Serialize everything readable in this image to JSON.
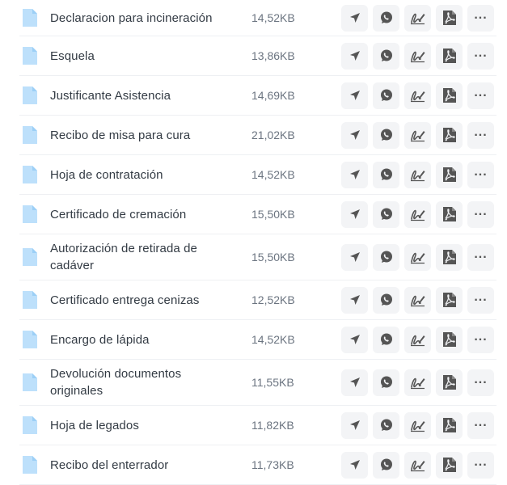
{
  "documents": [
    {
      "name": "Declaracion para incineración",
      "size": "14,52KB"
    },
    {
      "name": "Esquela",
      "size": "13,86KB"
    },
    {
      "name": "Justificante Asistencia",
      "size": "14,69KB"
    },
    {
      "name": "Recibo de misa para cura",
      "size": "21,02KB"
    },
    {
      "name": "Hoja de contratación",
      "size": "14,52KB"
    },
    {
      "name": "Certificado de cremación",
      "size": "15,50KB"
    },
    {
      "name": "Autorización de retirada de cadáver",
      "size": "15,50KB"
    },
    {
      "name": "Certificado entrega cenizas",
      "size": "12,52KB"
    },
    {
      "name": "Encargo de lápida",
      "size": "14,52KB"
    },
    {
      "name": "Devolución documentos originales",
      "size": "11,55KB"
    },
    {
      "name": "Hoja de legados",
      "size": "11,82KB"
    },
    {
      "name": "Recibo del enterrador",
      "size": "11,73KB"
    }
  ],
  "icons": {
    "file": "file-icon",
    "send": "send-icon",
    "whatsapp": "whatsapp-icon",
    "sign": "signature-icon",
    "pdf": "pdf-icon",
    "more": "more-icon"
  },
  "colors": {
    "file_icon": "#bde0fb",
    "action_bg": "#f3f4f6",
    "action_icon": "#555555"
  }
}
